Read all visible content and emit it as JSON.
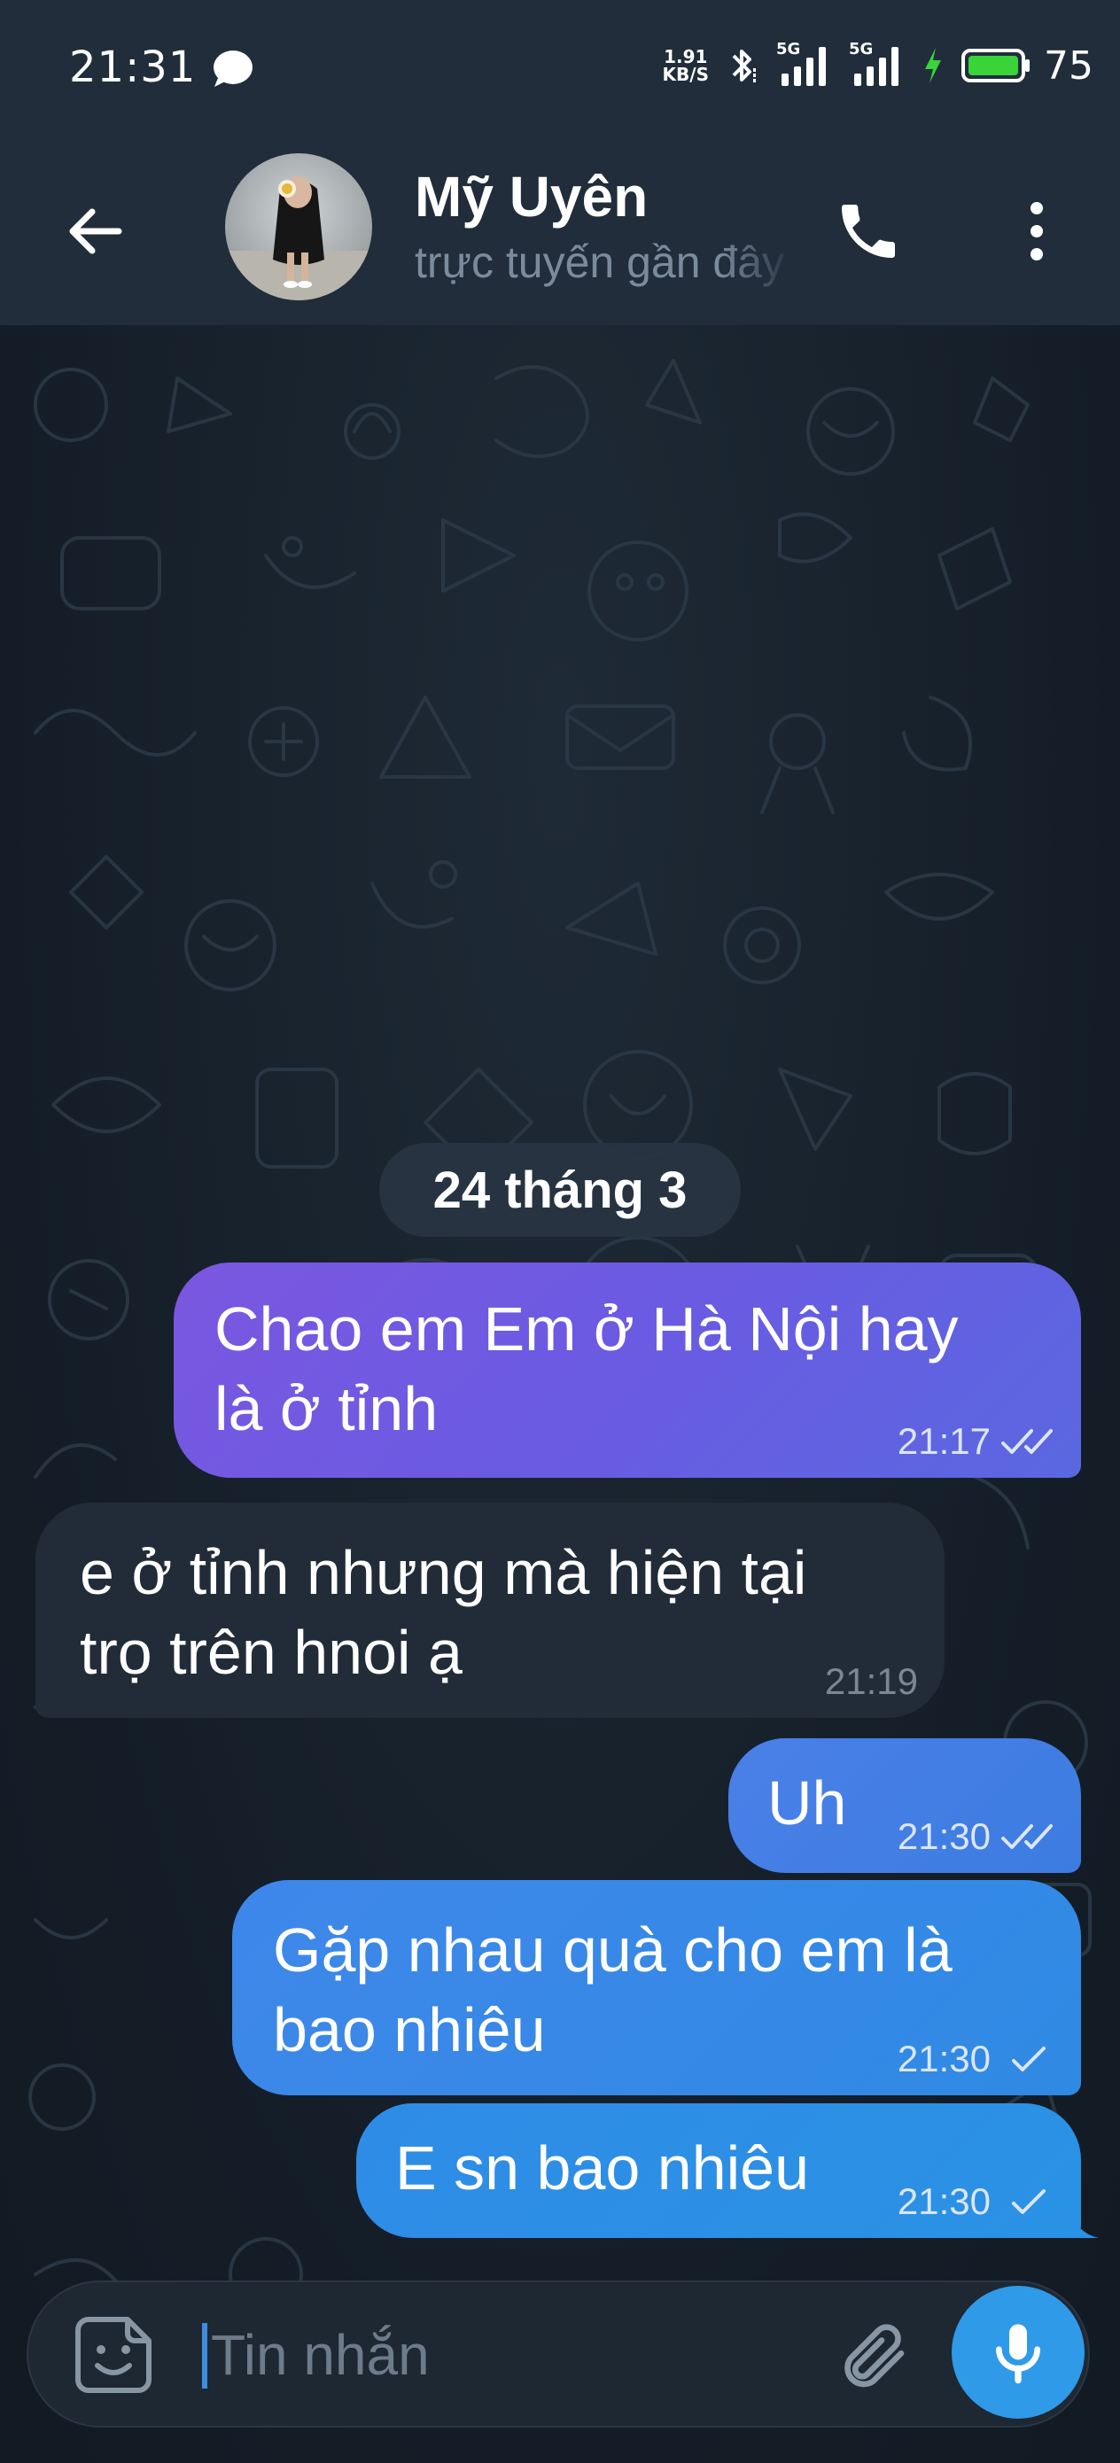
{
  "status_bar": {
    "time": "21:31",
    "net_speed_value": "1.91",
    "net_speed_unit": "KB/S",
    "sig1_label": "5G",
    "sig2_label": "5G",
    "battery_level": "75",
    "battery_color": "#39d33a"
  },
  "header": {
    "contact_name": "Mỹ Uyên",
    "contact_status": "trực tuyến gần đây"
  },
  "chat": {
    "date_separator": "24 tháng 3",
    "messages": [
      {
        "direction": "out",
        "text_line1": "Chao em Em ở Hà Nội hay",
        "text_line2": "là ở tỉnh",
        "time": "21:17",
        "status": "read"
      },
      {
        "direction": "in",
        "text_line1": "e ở tỉnh nhưng mà hiện tại",
        "text_line2": "trọ trên hnoi ạ",
        "time": "21:19"
      },
      {
        "direction": "out",
        "text_line1": "Uh",
        "time": "21:30",
        "status": "read"
      },
      {
        "direction": "out",
        "text_line1": "Gặp nhau quà cho em là",
        "text_line2": "bao nhiêu",
        "time": "21:30",
        "status": "sent"
      },
      {
        "direction": "out",
        "text_line1": "E sn bao nhiêu",
        "time": "21:30",
        "status": "sent"
      }
    ]
  },
  "composer": {
    "placeholder": "Tin nhắn",
    "value": ""
  },
  "icons": {
    "back": "arrow-left-icon",
    "call": "phone-icon",
    "menu": "more-vert-icon",
    "sticker": "sticker-icon",
    "attach": "paperclip-icon",
    "mic": "microphone-icon"
  },
  "colors": {
    "outgoing_first": "#6a5be2",
    "outgoing_last": "#2a92e4",
    "incoming": "#222c38",
    "accent": "#2f9ae8"
  }
}
